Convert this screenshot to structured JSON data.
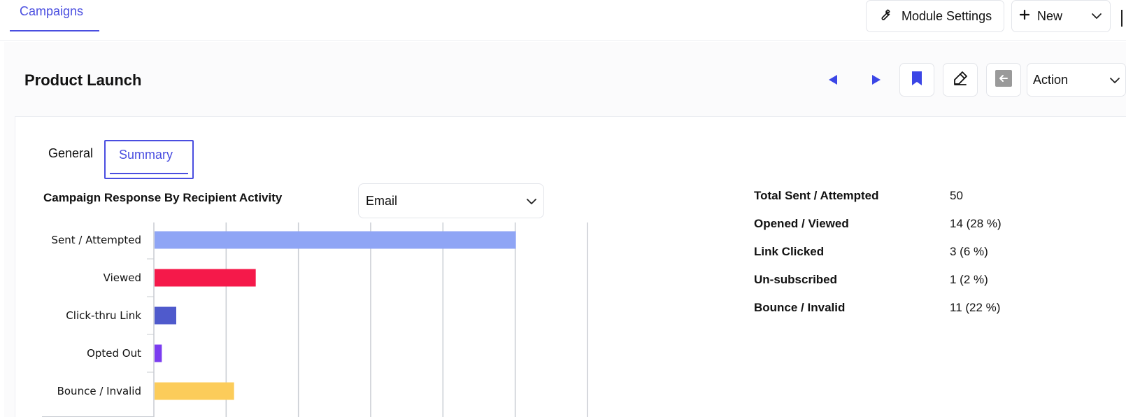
{
  "header": {
    "module_tab": "Campaigns",
    "module_settings_label": "Module Settings",
    "new_label": "New"
  },
  "record": {
    "title": "Product Launch",
    "action_label": "Action"
  },
  "tabs": {
    "general": "General",
    "summary": "Summary"
  },
  "chart_section": {
    "heading": "Campaign Response By Recipient Activity",
    "channel_select": "Email"
  },
  "chart_data": {
    "type": "bar",
    "orientation": "horizontal",
    "categories": [
      "Sent / Attempted",
      "Viewed",
      "Click-thru Link",
      "Opted Out",
      "Bounce / Invalid"
    ],
    "values": [
      50,
      14,
      3,
      1,
      11
    ],
    "colors": [
      "#8fa5f5",
      "#f5194a",
      "#4f5acc",
      "#7b3cf0",
      "#fccc5a"
    ],
    "xlim": [
      0,
      60
    ],
    "grid": true
  },
  "stats": [
    {
      "label": "Total Sent / Attempted",
      "value": "50"
    },
    {
      "label": "Opened / Viewed",
      "value": "14 (28 %)"
    },
    {
      "label": "Link Clicked",
      "value": "3 (6 %)"
    },
    {
      "label": "Un-subscribed",
      "value": "1 (2 %)"
    },
    {
      "label": "Bounce / Invalid",
      "value": "11 (22 %)"
    }
  ],
  "colors": {
    "accent": "#4a4ee0",
    "border": "#e3e5ea"
  }
}
